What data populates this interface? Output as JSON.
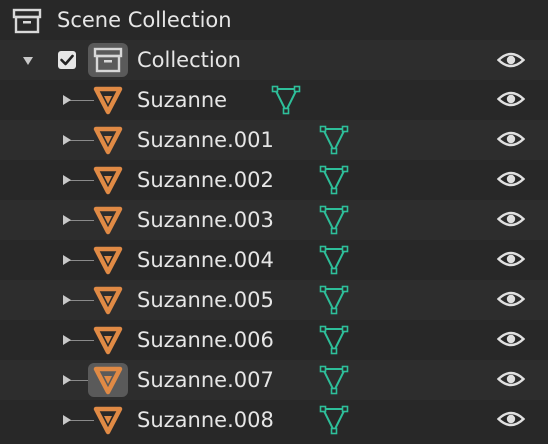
{
  "outliner": {
    "scene_collection": {
      "label": "Scene Collection",
      "icon": "scene-collection-icon"
    },
    "collection": {
      "label": "Collection",
      "icon": "collection-icon",
      "expanded": true,
      "checked": true
    },
    "objects": [
      {
        "label": "Suzanne",
        "selected": false
      },
      {
        "label": "Suzanne.001",
        "selected": false
      },
      {
        "label": "Suzanne.002",
        "selected": false
      },
      {
        "label": "Suzanne.003",
        "selected": false
      },
      {
        "label": "Suzanne.004",
        "selected": false
      },
      {
        "label": "Suzanne.005",
        "selected": false
      },
      {
        "label": "Suzanne.006",
        "selected": false
      },
      {
        "label": "Suzanne.007",
        "selected": true
      },
      {
        "label": "Suzanne.008",
        "selected": false
      }
    ],
    "colors": {
      "object_icon": "#e08a45",
      "mesh_icon": "#2ebf9a",
      "text": "#e6e6e6",
      "row_dark": "#282828",
      "row_light": "#2d2d2d"
    }
  }
}
